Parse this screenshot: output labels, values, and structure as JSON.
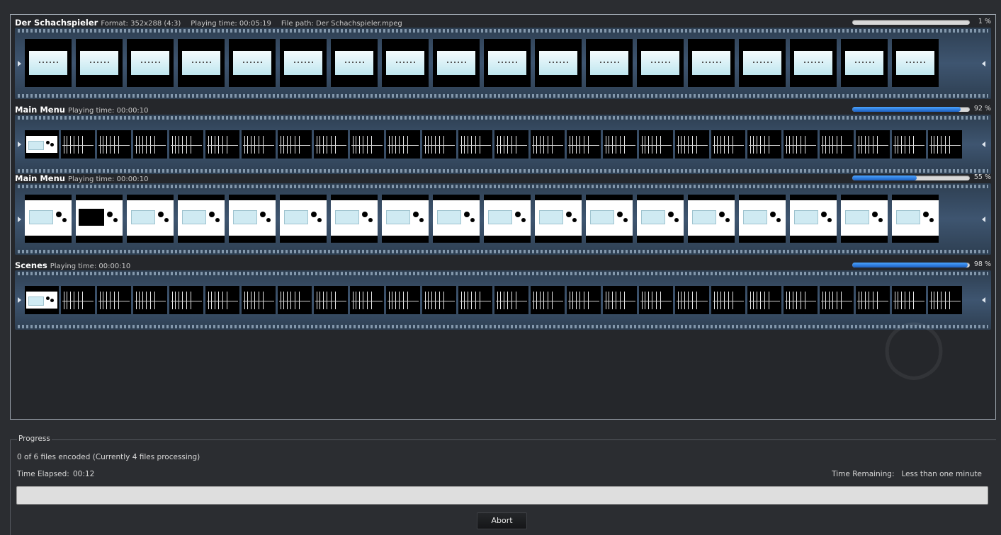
{
  "tracks": [
    {
      "title": "Der Schachspieler",
      "meta": [
        "Format: 352x288 (4:3)",
        "Playing time: 00:05:19",
        "File path: Der Schachspieler.mpeg"
      ],
      "progress": 0.01,
      "progress_text": "1 %",
      "kind": "video",
      "frame_count": 18
    },
    {
      "title": "Main Menu",
      "meta": [
        "Playing time: 00:00:10"
      ],
      "progress": 0.92,
      "progress_text": "92 %",
      "kind": "audio",
      "frame_count": 26
    },
    {
      "title": "Main Menu",
      "meta": [
        "Playing time: 00:00:10"
      ],
      "progress": 0.55,
      "progress_text": "55 %",
      "kind": "menu",
      "frame_count": 18
    },
    {
      "title": "Scenes",
      "meta": [
        "Playing time: 00:00:10"
      ],
      "progress": 0.98,
      "progress_text": "98 %",
      "kind": "audio",
      "frame_count": 26
    }
  ],
  "progress": {
    "group_title": "Progress",
    "status": "0 of 6 files encoded (Currently 4 files processing)",
    "elapsed_label": "Time Elapsed:",
    "elapsed_value": "00:12",
    "remaining_label": "Time Remaining:",
    "remaining_value": "Less than one minute",
    "overall_progress": 0.0
  },
  "buttons": {
    "abort": "Abort"
  },
  "colors": {
    "progress_fill": "#1d5fbf",
    "strip": "#3e5570",
    "background": "#2b2d31"
  }
}
